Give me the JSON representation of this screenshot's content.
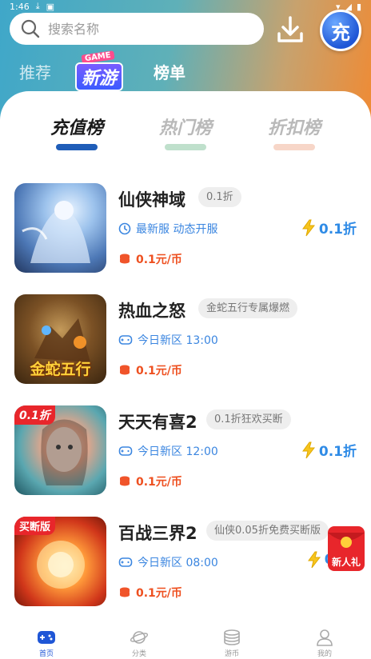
{
  "status_bar": {
    "time": "1:46"
  },
  "search": {
    "placeholder": "搜索名称"
  },
  "recharge_button": {
    "label": "充"
  },
  "top_tabs": {
    "recommend": "推荐",
    "new_game_badge": "GAME",
    "new_game": "新游",
    "ranking": "榜单"
  },
  "rank_tabs": [
    {
      "label": "充值榜",
      "color": "#1b1b1b",
      "underline": "#1f5db8"
    },
    {
      "label": "热门榜",
      "color": "#b9b9b9",
      "underline": "#bfe0cc"
    },
    {
      "label": "折扣榜",
      "color": "#b9b9b9",
      "underline": "#f7d6c8"
    }
  ],
  "games": [
    {
      "name": "仙侠神域",
      "tag": "0.1折",
      "meta_icon": "clock-icon",
      "meta": "最新服 动态开服",
      "price": "0.1元/币",
      "discount": "0.1折",
      "thumb_label": ""
    },
    {
      "name": "热血之怒",
      "tag": "金蛇五行专属爆燃",
      "meta_icon": "gamepad-icon",
      "meta": "今日新区 13:00",
      "price": "0.1元/币",
      "discount": "",
      "thumb_label": "金蛇五行"
    },
    {
      "name": "天天有喜2",
      "tag": "0.1折狂欢买断",
      "meta_icon": "gamepad-icon",
      "meta": "今日新区 12:00",
      "price": "0.1元/币",
      "discount": "0.1折",
      "thumb_label": "0.1折"
    },
    {
      "name": "百战三界2",
      "tag": "仙侠0.05折免费买断版",
      "meta_icon": "gamepad-icon",
      "meta": "今日新区 08:00",
      "price": "0.1元/币",
      "discount": "0.",
      "thumb_label": "买断版"
    }
  ],
  "float_gift": {
    "label": "新人礼"
  },
  "bottom_nav": [
    {
      "label": "首页",
      "icon": "gamepad-home-icon",
      "active": true
    },
    {
      "label": "分类",
      "icon": "planet-icon",
      "active": false
    },
    {
      "label": "游币",
      "icon": "coin-stack-icon",
      "active": false
    },
    {
      "label": "我的",
      "icon": "user-icon",
      "active": false
    }
  ]
}
